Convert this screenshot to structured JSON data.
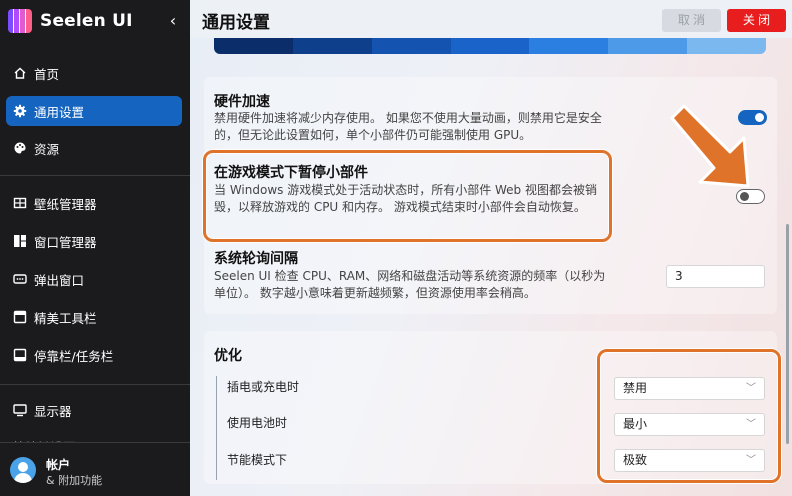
{
  "app": {
    "name": "Seelen UI",
    "collapse_glyph": "‹"
  },
  "sidebar": {
    "items": [
      {
        "label": "首页",
        "icon": "home-icon"
      },
      {
        "label": "通用设置",
        "icon": "gear-icon",
        "active": true
      },
      {
        "label": "资源",
        "icon": "palette-icon"
      },
      {
        "label": "壁纸管理器",
        "icon": "wallpaper-icon"
      },
      {
        "label": "窗口管理器",
        "icon": "window-manager-icon"
      },
      {
        "label": "弹出窗口",
        "icon": "popup-icon"
      },
      {
        "label": "精美工具栏",
        "icon": "toolbar-icon"
      },
      {
        "label": "停靠栏/任务栏",
        "icon": "dock-icon"
      },
      {
        "label": "显示器",
        "icon": "monitor-icon"
      }
    ],
    "partial_item": "快捷键设置",
    "account": {
      "name": "帐户",
      "subtitle": "& 附加功能"
    }
  },
  "header": {
    "title": "通用设置",
    "cancel_label": "取 消",
    "close_label": "关 闭"
  },
  "banner_colors": [
    "#0b2e6b",
    "#0d3f8a",
    "#1553b0",
    "#1a63c8",
    "#2b7fe0",
    "#4c9ae8",
    "#7ab8ef"
  ],
  "settings": {
    "hw_accel": {
      "title": "硬件加速",
      "desc": "禁用硬件加速将减少内存使用。 如果您不使用大量动画，则禁用它是安全的，但无论此设置如何，单个小部件仍可能强制使用 GPU。",
      "enabled": true
    },
    "game_mode": {
      "title": "在游戏模式下暂停小部件",
      "desc": "当 Windows 游戏模式处于活动状态时，所有小部件 Web 视图都会被销毁，以释放游戏的 CPU 和内存。 游戏模式结束时小部件会自动恢复。",
      "enabled": false
    },
    "poll": {
      "title": "系统轮询间隔",
      "desc": "Seelen UI 检查 CPU、RAM、网络和磁盘活动等系统资源的频率（以秒为单位）。 数字越小意味着更新越频繁，但资源使用率会稍高。",
      "value": "3"
    }
  },
  "optimize": {
    "title": "优化",
    "rows": [
      {
        "label": "插电或充电时",
        "value": "禁用"
      },
      {
        "label": "使用电池时",
        "value": "最小"
      },
      {
        "label": "节能模式下",
        "value": "极致"
      }
    ],
    "chevron": "﹀"
  },
  "colors": {
    "accent": "#1565c0",
    "highlight": "#e0732a",
    "close": "#e81e1e"
  }
}
